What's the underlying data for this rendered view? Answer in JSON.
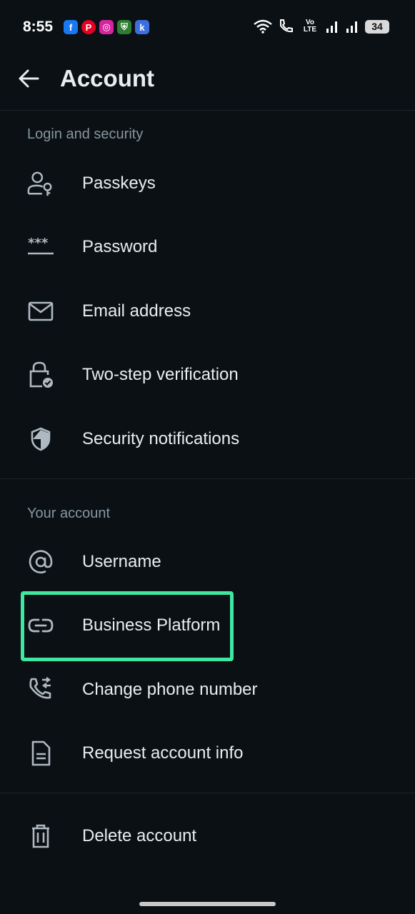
{
  "status_bar": {
    "time": "8:55",
    "notifications": [
      {
        "icon": "facebook-icon",
        "glyph": "f",
        "color": "#1877f2"
      },
      {
        "icon": "pinterest-icon",
        "glyph": "P",
        "color": "#e60023"
      },
      {
        "icon": "instagram-icon",
        "glyph": "◎",
        "color": "#d6249f"
      },
      {
        "icon": "shield-app-icon",
        "glyph": "⛨",
        "color": "#2e7d32"
      },
      {
        "icon": "k-app-icon",
        "glyph": "k",
        "color": "#3b6fe0"
      }
    ],
    "network_label": "Vo LTE",
    "battery": "34"
  },
  "header": {
    "title": "Account",
    "back_icon": "arrow-left-icon"
  },
  "sections": [
    {
      "label": "Login and security",
      "items": [
        {
          "label": "Passkeys",
          "icon": "passkey-icon"
        },
        {
          "label": "Password",
          "icon": "password-icon"
        },
        {
          "label": "Email address",
          "icon": "mail-icon"
        },
        {
          "label": "Two-step verification",
          "icon": "lock-check-icon"
        },
        {
          "label": "Security notifications",
          "icon": "shield-icon"
        }
      ]
    },
    {
      "label": "Your account",
      "items": [
        {
          "label": "Username",
          "icon": "at-icon"
        },
        {
          "label": "Business Platform",
          "icon": "link-icon"
        },
        {
          "label": "Change phone number",
          "icon": "phone-change-icon"
        },
        {
          "label": "Request account info",
          "icon": "document-icon"
        }
      ]
    },
    {
      "label": "",
      "items": [
        {
          "label": "Delete account",
          "icon": "trash-icon"
        }
      ]
    }
  ],
  "colors": {
    "background": "#0b1014",
    "text": "#e9edef",
    "secondary_text": "#8696a0",
    "highlight": "#3ee8a0"
  }
}
